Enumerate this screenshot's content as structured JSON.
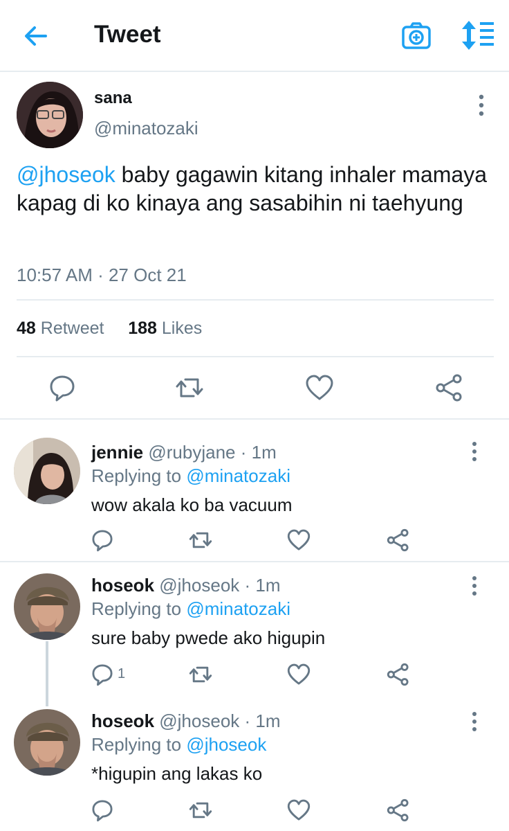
{
  "header": {
    "title": "Tweet",
    "back_icon": "arrow-left-icon",
    "camera_icon": "camera-plus-icon",
    "sort_icon": "sort-list-icon",
    "accent": "#1da1f2"
  },
  "main_tweet": {
    "name": "sana",
    "handle": "@minatozaki",
    "mention": "@jhoseok",
    "text": " baby gagawin kitang inhaler mamaya kapag di ko kinaya ang sasabihin ni taehyung",
    "timestamp": "10:57 AM · 27 Oct 21",
    "retweets_count": "48",
    "retweets_label": "Retweet",
    "likes_count": "188",
    "likes_label": "Likes"
  },
  "replies": [
    {
      "name": "jennie",
      "handle": "@rubyjane",
      "time": "· 1m",
      "replying_prefix": "Replying to",
      "replying_to": "@minatozaki",
      "text": "wow akala ko ba vacuum",
      "reply_count": ""
    },
    {
      "name": "hoseok",
      "handle": "@jhoseok",
      "time": "· 1m",
      "replying_prefix": "Replying to",
      "replying_to": "@minatozaki",
      "text": "sure baby pwede ako higupin",
      "reply_count": "1"
    },
    {
      "name": "hoseok",
      "handle": "@jhoseok",
      "time": "· 1m",
      "replying_prefix": "Replying to",
      "replying_to": "@jhoseok",
      "text": "*higupin ang lakas ko",
      "reply_count": ""
    }
  ]
}
